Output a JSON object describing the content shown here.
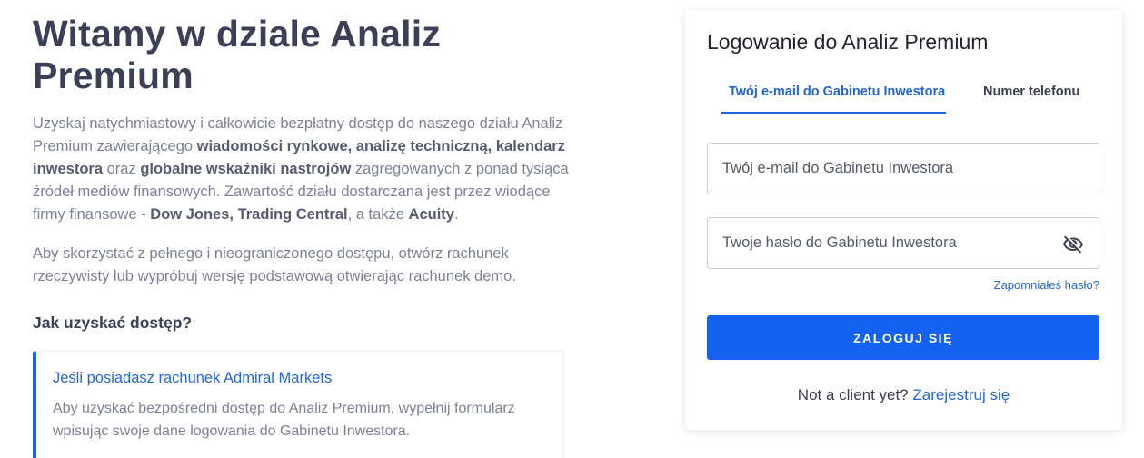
{
  "hero": {
    "title": "Witamy w dziale Analiz Premium"
  },
  "intro": {
    "p1": "Uzyskaj natychmiastowy i całkowicie bezpłatny dostęp do naszego działu Analiz Premium zawierającego ",
    "b1": "wiadomości rynkowe, analizę techniczną, kalendarz inwestora",
    "p2": " oraz ",
    "b2": "globalne wskaźniki nastrojów",
    "p3": " zagregowanych z ponad tysiąca źródeł mediów finansowych. Zawartość działu dostarczana jest przez wiodące firmy finansowe - ",
    "b3": "Dow Jones, Trading Central",
    "p4": ", a także ",
    "b4": "Acuity",
    "p5": "."
  },
  "access_note": "Aby skorzystać z pełnego i nieograniczonego dostępu, otwórz rachunek rzeczywisty lub wypróbuj wersję podstawową otwierając rachunek demo.",
  "section_heading": "Jak uzyskać dostęp?",
  "info_card": {
    "title": "Jeśli posiadasz rachunek Admiral Markets",
    "body": "Aby uzyskać bezpośredni dostęp do Analiz Premium, wypełnij formularz wpisując swoje dane logowania do Gabinetu Inwestora."
  },
  "login": {
    "title": "Logowanie do Analiz Premium",
    "tabs": [
      {
        "label": "Twój e-mail do Gabinetu Inwestora",
        "active": true
      },
      {
        "label": "Numer telefonu",
        "active": false
      }
    ],
    "email_placeholder": "Twój e-mail do Gabinetu Inwestora",
    "password_placeholder": "Twoje hasło do Gabinetu Inwestora",
    "password_toggle_icon": "eye-off-icon",
    "forgot_label": "Zapomniałeś hasło?",
    "submit_label": "ZALOGUJ SIĘ",
    "signup_text": "Not a client yet? ",
    "signup_link": "Zarejestruj się"
  },
  "colors": {
    "accent": "#1561f2",
    "link": "#2467d8",
    "heading": "#3c4057",
    "body_text": "#7d8195"
  }
}
